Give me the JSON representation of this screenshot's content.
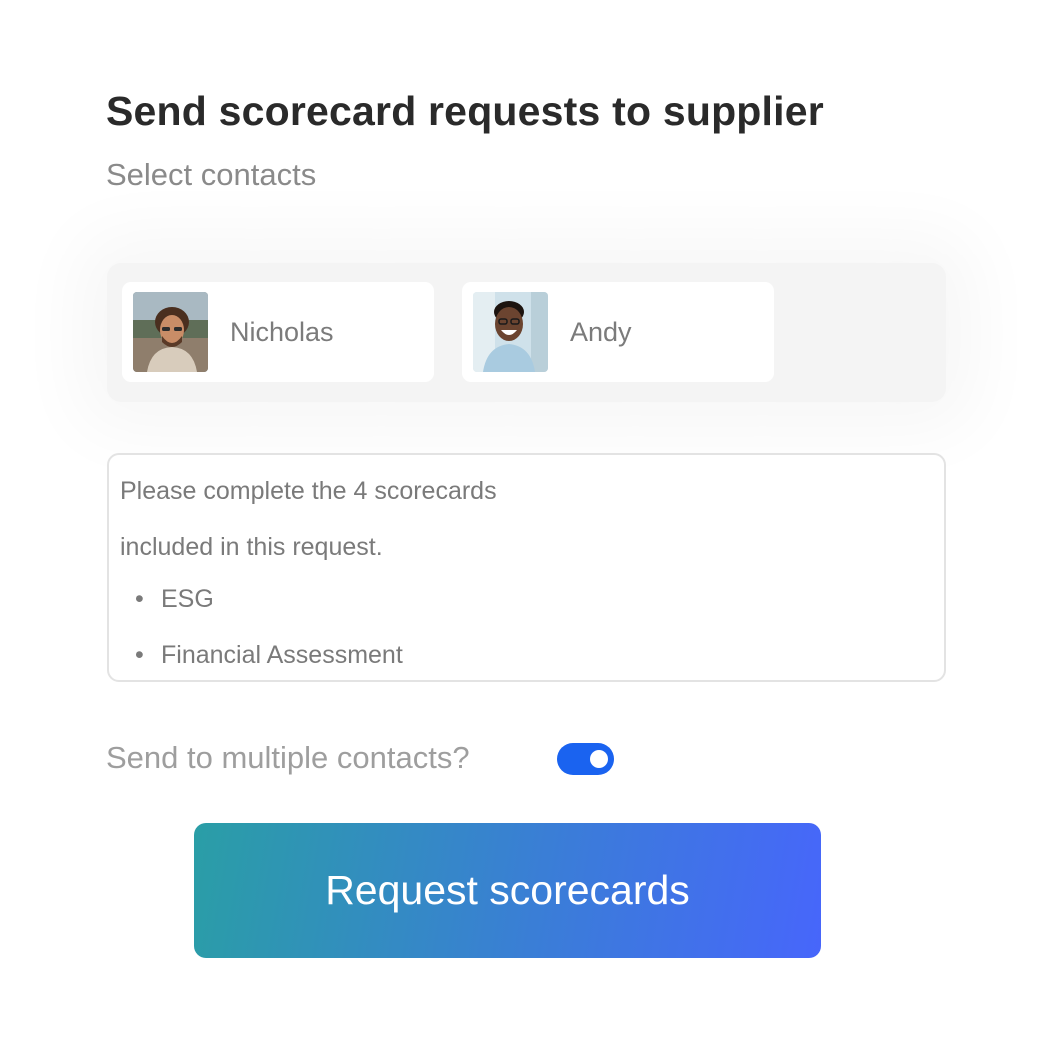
{
  "header": {
    "title": "Send scorecard requests to supplier",
    "subtitle": "Select contacts"
  },
  "contacts": [
    {
      "name": "Nicholas",
      "avatar_icon": "avatar-photo"
    },
    {
      "name": "Andy",
      "avatar_icon": "avatar-photo"
    }
  ],
  "message": {
    "lines": [
      "Please complete the 4 scorecards",
      "included in this request."
    ],
    "bullet_symbol": "•",
    "bullets": [
      "ESG",
      "Financial Assessment"
    ]
  },
  "toggle": {
    "label": "Send to multiple contacts?",
    "on": true,
    "color": "#1a63f0"
  },
  "button": {
    "label": "Request scorecards",
    "gradient_start": "#2a9ea6",
    "gradient_end": "#4766fb"
  }
}
